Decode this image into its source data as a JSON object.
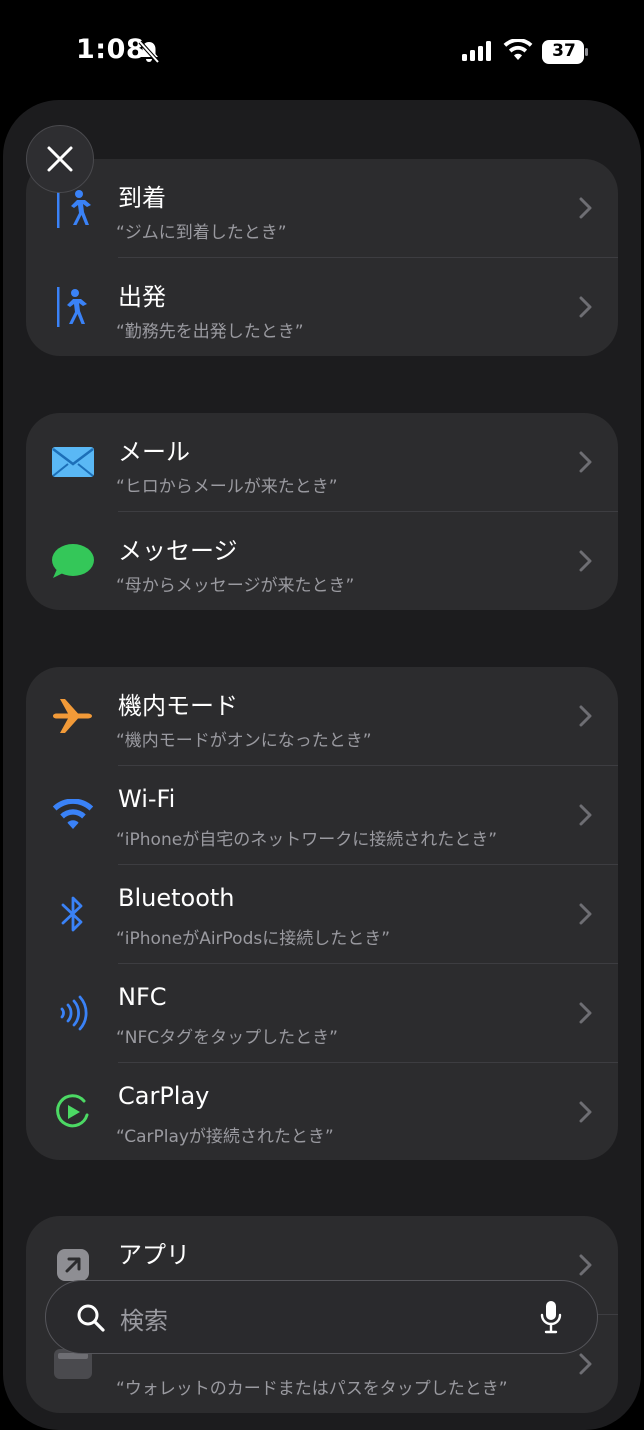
{
  "status_bar": {
    "time": "1:08",
    "battery": "37"
  },
  "groups": [
    {
      "rows": [
        {
          "icon": "person-arrival-icon",
          "title": "到着",
          "subtitle": "“ジムに到着したとき”"
        },
        {
          "icon": "person-departure-icon",
          "title": "出発",
          "subtitle": "“勤務先を出発したとき”"
        }
      ]
    },
    {
      "rows": [
        {
          "icon": "mail-icon",
          "title": "メール",
          "subtitle": "“ヒロからメールが来たとき”"
        },
        {
          "icon": "message-icon",
          "title": "メッセージ",
          "subtitle": "“母からメッセージが来たとき”"
        }
      ]
    },
    {
      "rows": [
        {
          "icon": "airplane-icon",
          "title": "機内モード",
          "subtitle": "“機内モードがオンになったとき”"
        },
        {
          "icon": "wifi-icon",
          "title": "Wi-Fi",
          "subtitle": "“iPhoneが自宅のネットワークに接続されたとき”"
        },
        {
          "icon": "bluetooth-icon",
          "title": "Bluetooth",
          "subtitle": "“iPhoneがAirPodsに接続したとき”"
        },
        {
          "icon": "nfc-icon",
          "title": "NFC",
          "subtitle": "“NFCタグをタップしたとき”"
        },
        {
          "icon": "carplay-icon",
          "title": "CarPlay",
          "subtitle": "“CarPlayが接続されたとき”"
        }
      ]
    },
    {
      "rows": [
        {
          "icon": "app-icon",
          "title": "アプリ",
          "subtitle": ""
        },
        {
          "icon": "wallet-icon",
          "title": "",
          "subtitle": "“ウォレットのカードまたはパスをタップしたとき”"
        }
      ]
    }
  ],
  "search": {
    "placeholder": "検索"
  },
  "colors": {
    "accent_blue": "#3a82f7",
    "airplane_orange": "#f29a38",
    "message_green": "#34c759",
    "carplay_green": "#4cd964"
  }
}
